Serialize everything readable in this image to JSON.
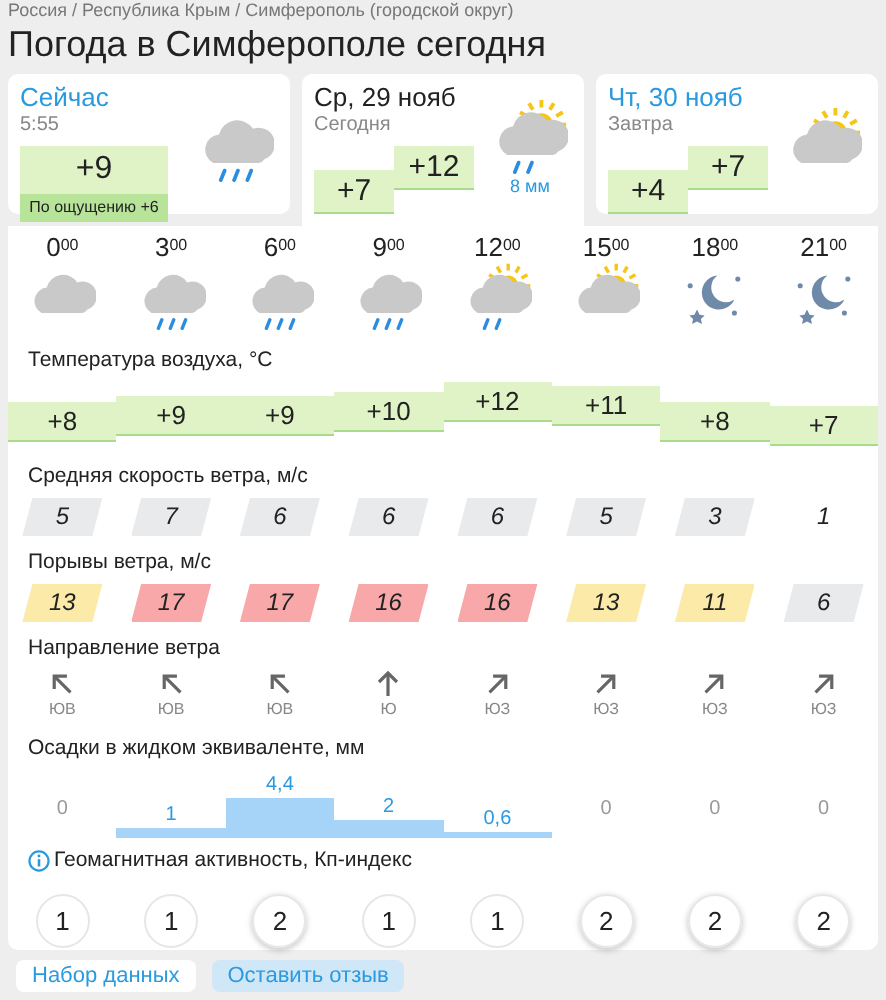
{
  "breadcrumb": "Россия / Республика Крым / Симферополь (городской округ)",
  "title": "Погода в Симферополе сегодня",
  "day_tabs": [
    {
      "title": "Сейчас",
      "subtitle": "5:55",
      "temp": "+9",
      "feels_like": "По ощущению +6",
      "kind": "cloudy-rain",
      "selected": false
    },
    {
      "title": "Ср, 29 нояб",
      "subtitle": "Сегодня",
      "temp_min": "+7",
      "temp_max": "+12",
      "kind": "partly-sunny-rain",
      "precip": "8 мм",
      "selected": true
    },
    {
      "title": "Чт, 30 нояб",
      "subtitle": "Завтра",
      "temp_min": "+4",
      "temp_max": "+7",
      "kind": "partly-sunny",
      "selected": false
    }
  ],
  "hours": [
    {
      "hour": "0",
      "minutes": "00",
      "kind": "cloudy"
    },
    {
      "hour": "3",
      "minutes": "00",
      "kind": "cloudy-rain"
    },
    {
      "hour": "6",
      "minutes": "00",
      "kind": "cloudy-rain"
    },
    {
      "hour": "9",
      "minutes": "00",
      "kind": "cloudy-rain"
    },
    {
      "hour": "12",
      "minutes": "00",
      "kind": "partly-sunny-rain"
    },
    {
      "hour": "15",
      "minutes": "00",
      "kind": "partly-sunny"
    },
    {
      "hour": "18",
      "minutes": "00",
      "kind": "night"
    },
    {
      "hour": "21",
      "minutes": "00",
      "kind": "night"
    }
  ],
  "temperature": {
    "label": "Температура воздуха, °C",
    "values": [
      "+8",
      "+9",
      "+9",
      "+10",
      "+12",
      "+11",
      "+8",
      "+7"
    ]
  },
  "wind_speed": {
    "label": "Средняя скорость ветра, м/с",
    "items": [
      {
        "value": "5",
        "highlighted": true
      },
      {
        "value": "7",
        "highlighted": true
      },
      {
        "value": "6",
        "highlighted": true
      },
      {
        "value": "6",
        "highlighted": true
      },
      {
        "value": "6",
        "highlighted": true
      },
      {
        "value": "5",
        "highlighted": true
      },
      {
        "value": "3",
        "highlighted": true
      },
      {
        "value": "1",
        "highlighted": false
      }
    ]
  },
  "wind_gusts": {
    "label": "Порывы ветра, м/с",
    "items": [
      {
        "value": "13",
        "color": "#fbeaa8"
      },
      {
        "value": "17",
        "color": "#f8a8a8"
      },
      {
        "value": "17",
        "color": "#f8a8a8"
      },
      {
        "value": "16",
        "color": "#f8a8a8"
      },
      {
        "value": "16",
        "color": "#f8a8a8"
      },
      {
        "value": "13",
        "color": "#fbeaa8"
      },
      {
        "value": "11",
        "color": "#fbeaa8"
      },
      {
        "value": "6",
        "color": "#e9eaec"
      }
    ]
  },
  "wind_direction": {
    "label": "Направление ветра",
    "items": [
      {
        "label": "ЮВ",
        "kind": "se"
      },
      {
        "label": "ЮВ",
        "kind": "se"
      },
      {
        "label": "ЮВ",
        "kind": "se"
      },
      {
        "label": "Ю",
        "kind": "s"
      },
      {
        "label": "ЮЗ",
        "kind": "sw"
      },
      {
        "label": "ЮЗ",
        "kind": "sw"
      },
      {
        "label": "ЮЗ",
        "kind": "sw"
      },
      {
        "label": "ЮЗ",
        "kind": "sw"
      }
    ]
  },
  "precipitation": {
    "label": "Осадки в жидком эквиваленте, мм",
    "items": [
      {
        "value": "0"
      },
      {
        "value": "1"
      },
      {
        "value": "4,4"
      },
      {
        "value": "2"
      },
      {
        "value": "0,6"
      },
      {
        "value": "0"
      },
      {
        "value": "0"
      },
      {
        "value": "0"
      }
    ]
  },
  "geomagnetic": {
    "label": "Геомагнитная активность, Кп-индекс",
    "values": [
      "1",
      "1",
      "2",
      "1",
      "1",
      "2",
      "2",
      "2"
    ]
  },
  "buttons": [
    "Набор данных",
    "Оставить отзыв"
  ]
}
